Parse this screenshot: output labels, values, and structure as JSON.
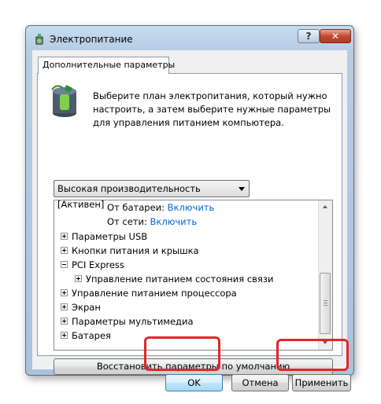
{
  "window": {
    "title": "Электропитание",
    "help_label": "?",
    "close_label": "✕"
  },
  "tab": {
    "label": "Дополнительные параметры"
  },
  "description": "Выберите план электропитания, который нужно настроить, а затем выберите нужные параметры для управления питанием компьютера.",
  "plan_select": {
    "selected": "Высокая производительность [Активен]"
  },
  "tree": {
    "items": [
      {
        "label": "От батареи:",
        "value": "Включить"
      },
      {
        "label": "От сети:",
        "value": "Включить"
      },
      {
        "label": "Параметры USB"
      },
      {
        "label": "Кнопки питания и крышка"
      },
      {
        "label": "PCI Express"
      },
      {
        "label": "Управление питанием состояния связи"
      },
      {
        "label": "Управление питанием процессора"
      },
      {
        "label": "Экран"
      },
      {
        "label": "Параметры мультимедиа"
      },
      {
        "label": "Батарея"
      }
    ]
  },
  "buttons": {
    "restore_defaults": "Восстановить параметры по умолчанию",
    "ok": "OK",
    "cancel": "Отмена",
    "apply": "Применить"
  },
  "colors": {
    "link": "#0066cc",
    "highlight": "#e3262a"
  }
}
